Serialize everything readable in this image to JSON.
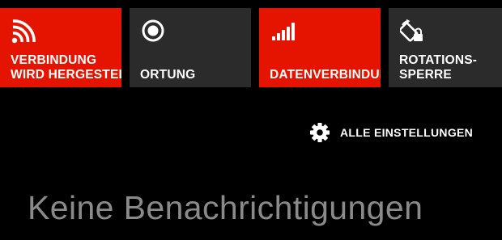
{
  "quick_actions": [
    {
      "id": "wifi",
      "icon": "wifi-icon",
      "color": "#e51400",
      "lines": [
        "VERBINDUNG",
        "WIRD HERGESTELLT"
      ]
    },
    {
      "id": "location",
      "icon": "location-icon",
      "color": "#2b2b2b",
      "lines": [
        "ORTUNG"
      ]
    },
    {
      "id": "data",
      "icon": "cellular-signal-icon",
      "color": "#e51400",
      "lines": [
        "DATENVERBINDUNG"
      ]
    },
    {
      "id": "rotation",
      "icon": "rotation-lock-icon",
      "color": "#2b2b2b",
      "lines": [
        "ROTATIONS-",
        "SPERRE"
      ]
    }
  ],
  "all_settings": {
    "icon": "gear-icon",
    "label": "ALLE EINSTELLUNGEN"
  },
  "notifications": {
    "empty_text": "Keine Benachrichtigungen"
  },
  "colors": {
    "accent": "#e51400",
    "tile_inactive": "#2b2b2b",
    "background": "#000000",
    "muted_text": "#8a8a8a"
  }
}
